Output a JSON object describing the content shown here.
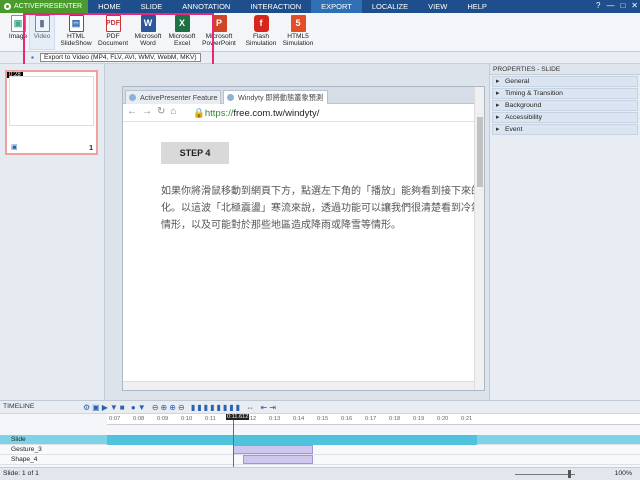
{
  "menubar": {
    "app_tab": "ACTIVEPRESENTER",
    "items": [
      "HOME",
      "SLIDE",
      "ANNOTATION",
      "INTERACTION",
      "EXPORT",
      "LOCALIZE",
      "VIEW",
      "HELP"
    ],
    "active": "EXPORT",
    "window_controls": [
      "?",
      "—",
      "□",
      "✕"
    ]
  },
  "ribbon": {
    "buttons": [
      {
        "label": "Image",
        "icon": "image-icon"
      },
      {
        "label": "Video",
        "icon": "video-icon"
      },
      {
        "label": "HTML\nSlideShow",
        "icon": "html-slideshow-icon"
      },
      {
        "label": "PDF\nDocument",
        "icon": "pdf-icon"
      },
      {
        "label": "Microsoft\nWord",
        "icon": "word-icon"
      },
      {
        "label": "Microsoft\nExcel",
        "icon": "excel-icon"
      },
      {
        "label": "Microsoft\nPowerPoint",
        "icon": "powerpoint-icon"
      },
      {
        "label": "Flash\nSimulation",
        "icon": "flash-icon"
      },
      {
        "label": "HTML5\nSimulation",
        "icon": "html5-icon"
      }
    ],
    "tooltip": "Export to Video (MP4, FLV, AVI, WMV, WebM, MKV)"
  },
  "slides_panel": {
    "thumb_time": "0:28",
    "thumb_number": "1"
  },
  "slide": {
    "tabs": [
      "ActivePresenter Feature",
      "Windyty 即將動態叢象預測"
    ],
    "url_scheme": "https://",
    "url_host": "free.com.tw/windyty/",
    "step_label": "STEP 4",
    "paragraph": "如果你將滑鼠移動到網頁下方，點選左下角的「播放」能夠看到接下來的\n化。以這波「北極震盪」寒流來說，透過功能可以讓我們很清楚看到冷氣\n情形，以及可能對於那些地區造成降雨或降雪等情形。"
  },
  "properties": {
    "title": "PROPERTIES - SLIDE",
    "sections": [
      "General",
      "Timing & Transition",
      "Background",
      "Accessibility",
      "Event"
    ]
  },
  "timeline": {
    "title": "TIMELINE",
    "ruler": [
      "0:07",
      "0:08",
      "0:09",
      "0:10",
      "0:11",
      "0:12",
      "0:13",
      "0:14",
      "0:15",
      "0:16",
      "0:17",
      "0:18",
      "0:19",
      "0:20",
      "0:21"
    ],
    "playhead": "0:11.612",
    "layers": [
      "Slide",
      "Gesture_3",
      "Shape_4"
    ]
  },
  "status": {
    "left": "Slide: 1 of 1",
    "zoom": "100%"
  },
  "colors": {
    "menubar": "#1e4f8c",
    "app_tab": "#4a9a2e",
    "highlight": "#e8267a"
  }
}
